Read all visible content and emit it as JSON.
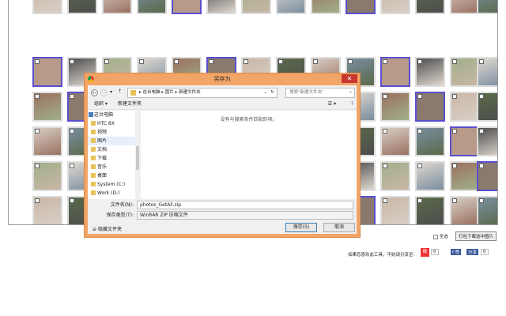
{
  "dialog": {
    "title": "另存为",
    "close": "✕",
    "path": [
      "这台电脑",
      "图片",
      "新建文件夹"
    ],
    "search_placeholder": "搜索\"新建文件夹\"",
    "organize": "组织 ▾",
    "new_folder": "新建文件夹",
    "empty_message": "没有与搜索条件匹配的项。",
    "nav_items": [
      {
        "label": "这台电脑"
      },
      {
        "label": "HTC 8X"
      },
      {
        "label": "视频"
      },
      {
        "label": "图片",
        "selected": true
      },
      {
        "label": "文档"
      },
      {
        "label": "下载"
      },
      {
        "label": "音乐"
      },
      {
        "label": "桌面"
      },
      {
        "label": "System (C:)"
      },
      {
        "label": "Work (D:)"
      }
    ],
    "filename_label": "文件名(N):",
    "filename_value": "photos_GetAll.zip",
    "filetype_label": "保存类型(T):",
    "filetype_value": "WinRAR ZIP 压缩文件",
    "hide_folders": "隐藏文件夹",
    "save": "保存(S)",
    "cancel": "取消"
  },
  "page": {
    "select_all": "全选",
    "download_button": "打包下载选中图片",
    "share_prompt": "如果您喜欢此工具，不妨请分享至：",
    "weibo_count": "0",
    "fb_like": "f 赞",
    "fb_share": "分享",
    "fb_count": "0"
  }
}
